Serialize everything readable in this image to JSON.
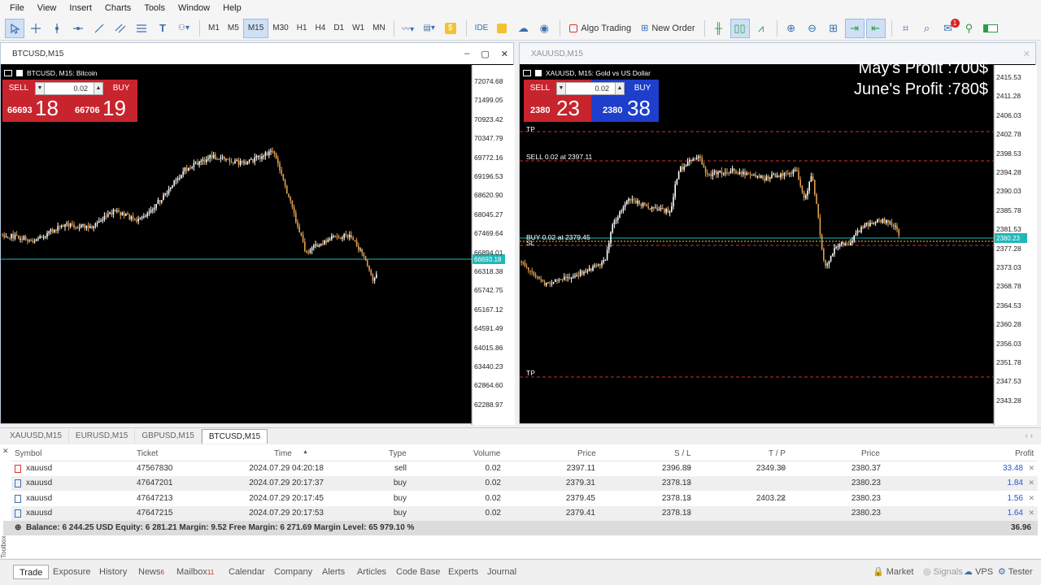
{
  "menu": [
    "File",
    "View",
    "Insert",
    "Charts",
    "Tools",
    "Window",
    "Help"
  ],
  "toolbar": {
    "timeframes": [
      "M1",
      "M5",
      "M15",
      "M30",
      "H1",
      "H4",
      "D1",
      "W1",
      "MN"
    ],
    "active_timeframe": "M15",
    "ide": "IDE",
    "algo_trading": "Algo Trading",
    "new_order": "New Order",
    "notification_count": "1"
  },
  "btc_window": {
    "title": "BTCUSD,M15",
    "chart_label": "BTCUSD, M15:  Bitcoin",
    "ticket": {
      "sell": "SELL",
      "buy": "BUY",
      "volume": "0.02",
      "sell_small": "66693",
      "sell_big": "18",
      "buy_small": "66706",
      "buy_big": "19"
    },
    "axis": [
      "72074.68",
      "71499.05",
      "70923.42",
      "70347.79",
      "69772.16",
      "69196.53",
      "68620.90",
      "68045.27",
      "67469.64",
      "66894.01",
      "66318.38",
      "65742.75",
      "65167.12",
      "64591.49",
      "64015.86",
      "63440.23",
      "62864.60",
      "62288.97"
    ],
    "current_price_tag": "66693.18"
  },
  "xau_window": {
    "title": "XAUUSD,M15",
    "chart_label": "XAUUSD, M15:  Gold vs US Dollar",
    "ticket": {
      "sell": "SELL",
      "buy": "BUY",
      "volume": "0.02",
      "sell_small": "2380",
      "sell_big": "23",
      "buy_small": "2380",
      "buy_big": "38"
    },
    "axis": [
      "2415.53",
      "2411.28",
      "2406.03",
      "2402.78",
      "2398.53",
      "2394.28",
      "2390.03",
      "2385.78",
      "2381.53",
      "2377.28",
      "2373.03",
      "2368.78",
      "2364.53",
      "2360.28",
      "2356.03",
      "2351.78",
      "2347.53",
      "2343.28"
    ],
    "current_price_tag": "2380.23",
    "line_labels": {
      "tp_top": "TP",
      "sell": "SELL 0.02 at 2397.11",
      "buy": "BUY 0.02 at 2379.45",
      "sl": "SL",
      "tp_bottom": "TP"
    },
    "overlay": {
      "may": "May's Profit :700$",
      "june": "June's Profit :780$"
    }
  },
  "chart_tabs": [
    "XAUUSD,M15",
    "EURUSD,M15",
    "GBPUSD,M15",
    "BTCUSD,M15"
  ],
  "active_chart_tab": "BTCUSD,M15",
  "trade_table": {
    "headers": {
      "symbol": "Symbol",
      "ticket": "Ticket",
      "time": "Time",
      "type": "Type",
      "volume": "Volume",
      "price": "Price",
      "sl": "S / L",
      "tp": "T / P",
      "price2": "Price",
      "profit": "Profit"
    },
    "rows": [
      {
        "symbol": "xauusd",
        "ticket": "47567830",
        "time": "2024.07.29 04:20:18",
        "type": "sell",
        "volume": "0.02",
        "price": "2397.11",
        "sl": "2396.89",
        "tp": "2349.30",
        "price2": "2380.37",
        "profit": "33.48"
      },
      {
        "symbol": "xauusd",
        "ticket": "47647201",
        "time": "2024.07.29 20:17:37",
        "type": "buy",
        "volume": "0.02",
        "price": "2379.31",
        "sl": "2378.13",
        "tp": "",
        "price2": "2380.23",
        "profit": "1.84"
      },
      {
        "symbol": "xauusd",
        "ticket": "47647213",
        "time": "2024.07.29 20:17:45",
        "type": "buy",
        "volume": "0.02",
        "price": "2379.45",
        "sl": "2378.13",
        "tp": "2403.22",
        "price2": "2380.23",
        "profit": "1.56"
      },
      {
        "symbol": "xauusd",
        "ticket": "47647215",
        "time": "2024.07.29 20:17:53",
        "type": "buy",
        "volume": "0.02",
        "price": "2379.41",
        "sl": "2378.13",
        "tp": "",
        "price2": "2380.23",
        "profit": "1.64"
      }
    ],
    "balance_line": "Balance: 6 244.25 USD  Equity: 6 281.21  Margin: 9.52  Free Margin: 6 271.69  Margin Level: 65 979.10 %",
    "total_profit": "36.96"
  },
  "bottom_tabs": {
    "trade": "Trade",
    "exposure": "Exposure",
    "history": "History",
    "news": "News",
    "news_badge": "6",
    "mailbox": "Mailbox",
    "mailbox_badge": "11",
    "calendar": "Calendar",
    "company": "Company",
    "alerts": "Alerts",
    "articles": "Articles",
    "codebase": "Code Base",
    "experts": "Experts",
    "journal": "Journal"
  },
  "status": {
    "market": "Market",
    "signals": "Signals",
    "vps": "VPS",
    "tester": "Tester",
    "toolbox": "Toolbox"
  },
  "colors": {
    "sell": "#c8242d",
    "buy_red": "#c8242d",
    "buy_blue": "#1e3ecc",
    "price_line": "#1fb8b8",
    "tp_line": "#d32f2f",
    "profit_link": "#2a55d4"
  }
}
